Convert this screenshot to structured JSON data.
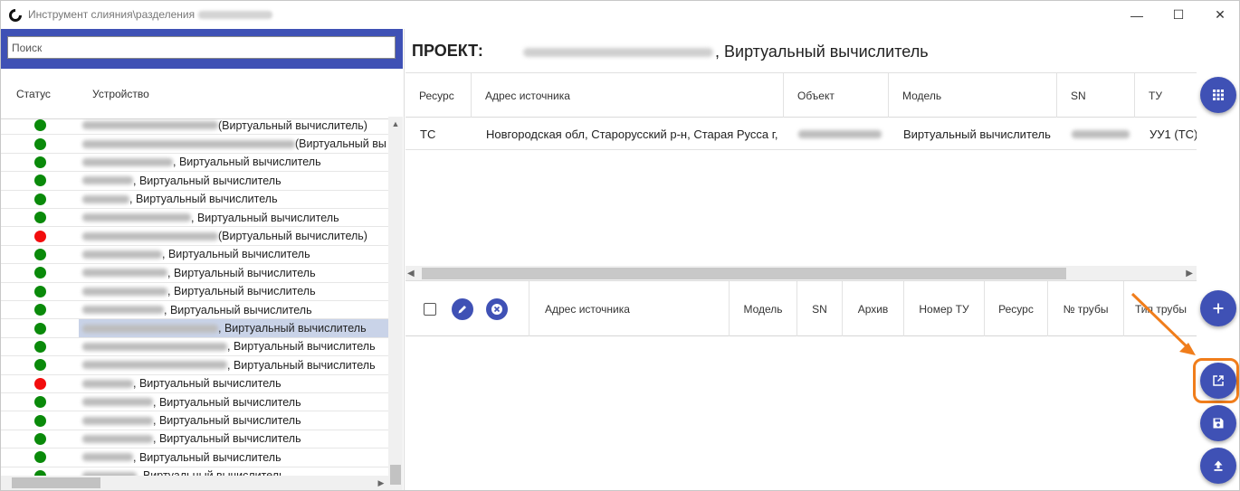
{
  "window": {
    "title": "Инструмент слияния\\разделения",
    "controls": {
      "minimize": "—",
      "maximize": "☐",
      "close": "✕"
    }
  },
  "search": {
    "placeholder": "Поиск",
    "value": ""
  },
  "device_list": {
    "columns": {
      "status": "Статус",
      "device": "Устройство"
    },
    "colors": {
      "ok": "#0a8a0a",
      "error": "#f20d0d",
      "selected": "#c9d3e8"
    },
    "rows": [
      {
        "status": "ok",
        "suffix": "(Виртуальный вычислитель)"
      },
      {
        "status": "ok",
        "suffix": "(Виртуальный вы"
      },
      {
        "status": "ok",
        "suffix": ", Виртуальный вычислитель"
      },
      {
        "status": "ok",
        "suffix": ", Виртуальный вычислитель"
      },
      {
        "status": "ok",
        "suffix": ", Виртуальный вычислитель"
      },
      {
        "status": "ok",
        "suffix": ", Виртуальный вычислитель"
      },
      {
        "status": "error",
        "suffix": "(Виртуальный вычислитель)"
      },
      {
        "status": "ok",
        "suffix": ", Виртуальный вычислитель"
      },
      {
        "status": "ok",
        "suffix": ", Виртуальный вычислитель"
      },
      {
        "status": "ok",
        "suffix": ", Виртуальный вычислитель"
      },
      {
        "status": "ok",
        "suffix": ", Виртуальный вычислитель"
      },
      {
        "status": "ok",
        "suffix": ", Виртуальный вычислитель",
        "selected": true
      },
      {
        "status": "ok",
        "suffix": ", Виртуальный вычислитель"
      },
      {
        "status": "ok",
        "suffix": ", Виртуальный вычислитель"
      },
      {
        "status": "error",
        "suffix": ", Виртуальный вычислитель"
      },
      {
        "status": "ok",
        "suffix": ", Виртуальный вычислитель"
      },
      {
        "status": "ok",
        "suffix": ", Виртуальный вычислитель"
      },
      {
        "status": "ok",
        "suffix": ", Виртуальный вычислитель"
      },
      {
        "status": "ok",
        "suffix": ", Виртуальный вычислитель"
      },
      {
        "status": "ok",
        "suffix": ", Виртуальный вычислитель"
      }
    ]
  },
  "project": {
    "label": "ПРОЕКТ:",
    "name": ", Виртуальный вычислитель"
  },
  "top_table": {
    "headers": [
      "Ресурс",
      "Адрес источника",
      "Объект",
      "Модель",
      "SN",
      "ТУ"
    ],
    "row": {
      "resource": "ТС",
      "address": "Новгородская обл, Старорусский р-н, Старая Русса г,",
      "object": "",
      "model": "Виртуальный вычислитель",
      "sn": "",
      "tu": "УУ1 (ТС)"
    }
  },
  "bottom_table": {
    "headers": [
      "Адрес источника",
      "Модель",
      "SN",
      "Архив",
      "Номер ТУ",
      "Ресурс",
      "№ трубы",
      "Тип трубы"
    ]
  },
  "icons": {
    "app": "app-logo-icon",
    "grid": "grid-icon",
    "add": "plus-icon",
    "open": "open-external-icon",
    "save": "save-icon",
    "upload": "upload-icon",
    "edit": "pencil-icon",
    "remove": "close-circle-icon"
  },
  "accent": "#3f51b5",
  "highlight": "#f07d1b"
}
